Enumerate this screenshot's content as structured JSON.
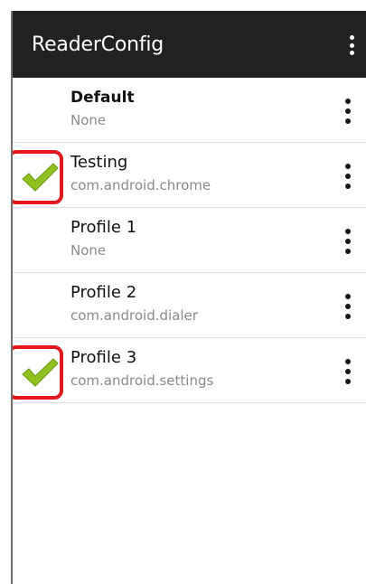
{
  "app": {
    "title": "ReaderConfig",
    "overflow_icon": "more-vertical-icon"
  },
  "profiles": [
    {
      "name": "Default",
      "app": "None",
      "selected": false,
      "bold": true
    },
    {
      "name": "Testing",
      "app": "com.android.chrome",
      "selected": true,
      "bold": false
    },
    {
      "name": "Profile 1",
      "app": "None",
      "selected": false,
      "bold": false
    },
    {
      "name": "Profile 2",
      "app": "com.android.dialer",
      "selected": false,
      "bold": false
    },
    {
      "name": "Profile 3",
      "app": "com.android.settings",
      "selected": true,
      "bold": false
    }
  ],
  "icons": {
    "selected": "green-checkmark-icon",
    "row_menu": "more-vertical-icon"
  },
  "colors": {
    "appbar": "#212121",
    "check": "#8dc21f",
    "highlight": "#e3171e"
  }
}
